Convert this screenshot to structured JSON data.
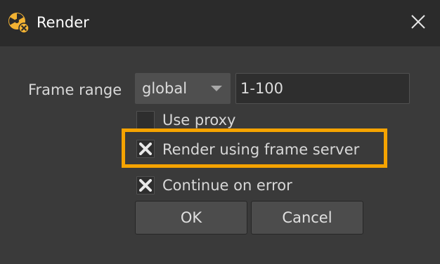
{
  "window": {
    "title": "Render"
  },
  "form": {
    "frame_range_label": "Frame range",
    "frame_range_mode": "global",
    "frame_range_value": "1-100",
    "use_proxy": {
      "label": "Use proxy",
      "checked": false
    },
    "render_using_frame_server": {
      "label": "Render using frame server",
      "checked": true
    },
    "continue_on_error": {
      "label": "Continue on error",
      "checked": true
    }
  },
  "buttons": {
    "ok": "OK",
    "cancel": "Cancel"
  },
  "colors": {
    "highlight": "#f5a300",
    "titlebar": "#2b2b2b",
    "background": "#3a3a3a"
  }
}
